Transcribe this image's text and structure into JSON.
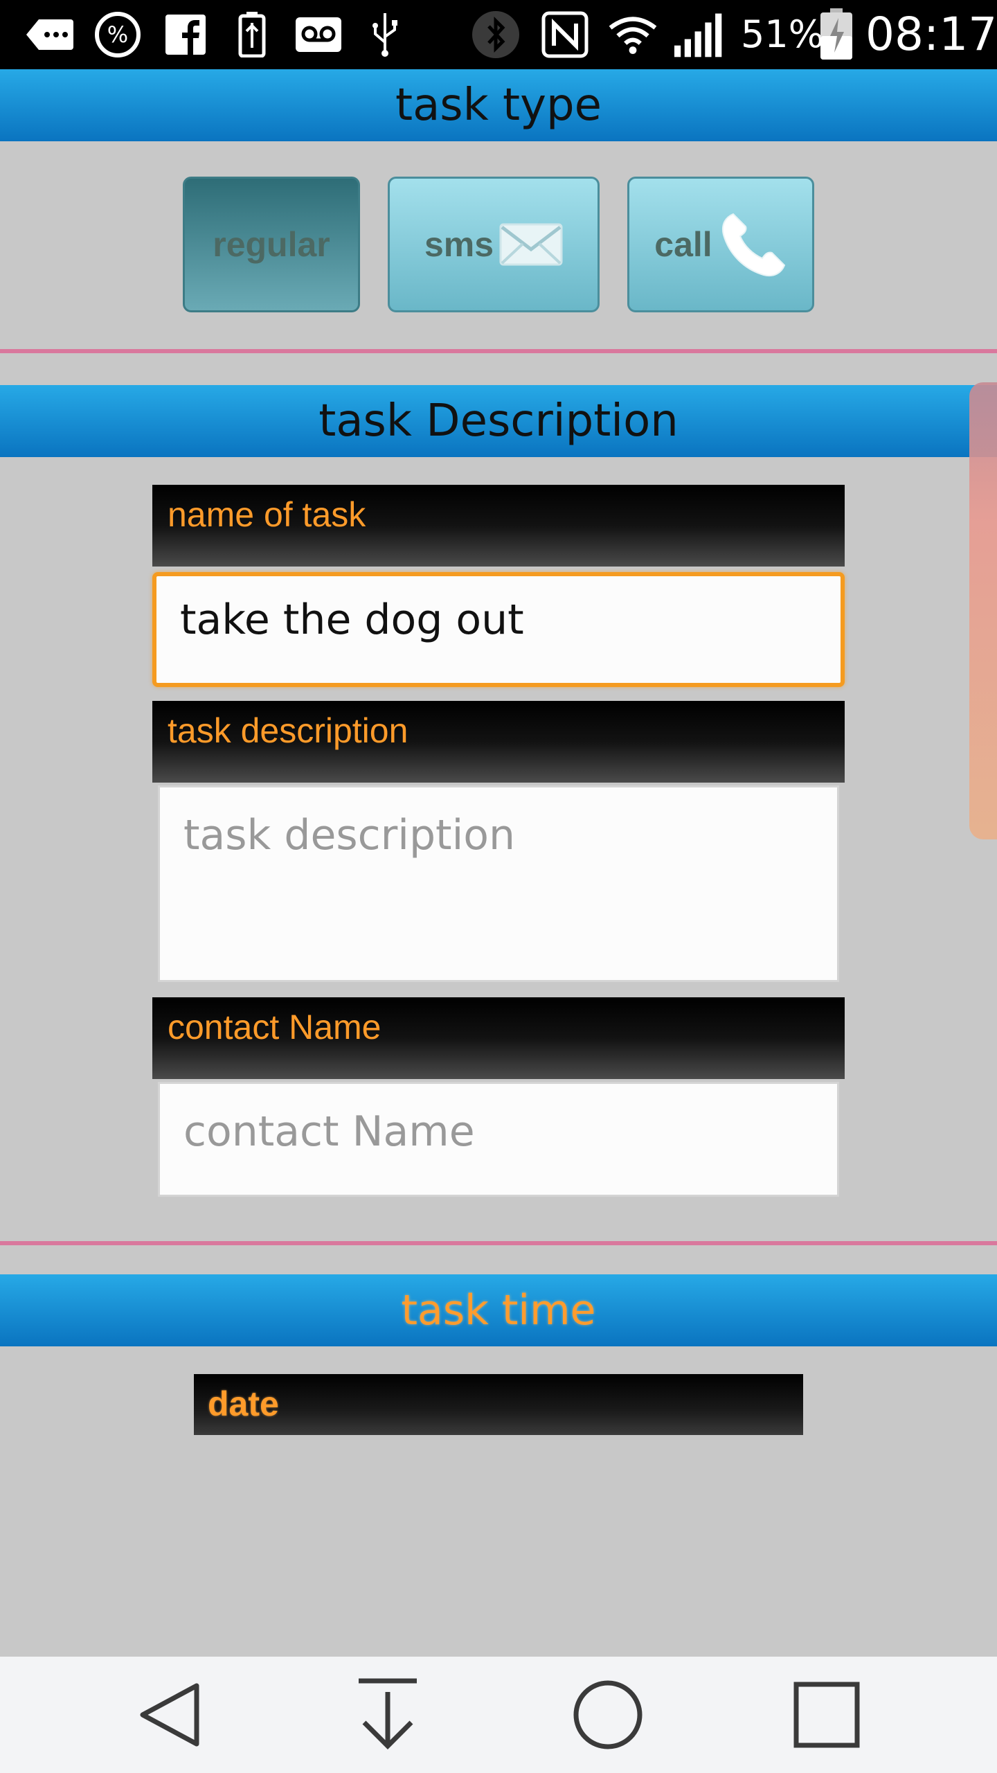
{
  "status_bar": {
    "battery_percent": "51%",
    "time": "08:17",
    "icons": [
      "more-icon",
      "percent-icon",
      "facebook-icon",
      "usb-battery-icon",
      "voicemail-icon",
      "usb-icon",
      "bluetooth-icon",
      "nfc-icon",
      "wifi-icon",
      "signal-icon",
      "battery-charging-icon"
    ]
  },
  "task_type": {
    "header": "task type",
    "buttons": [
      {
        "label": "regular",
        "active": true
      },
      {
        "label": "sms",
        "icon": "envelope-icon"
      },
      {
        "label": "call",
        "icon": "phone-icon"
      }
    ]
  },
  "task_description": {
    "header": "task Description",
    "name_label": "name of task",
    "name_value": "take the dog out",
    "description_label": "task description",
    "description_placeholder": "task description",
    "contact_label": "contact Name",
    "contact_placeholder": "contact Name"
  },
  "task_time": {
    "header": "task time",
    "date_label": "date"
  },
  "nav_bar": {
    "buttons": [
      "back-icon",
      "download-icon",
      "home-icon",
      "recents-icon"
    ]
  },
  "colors": {
    "header_blue": "#1a8fd6",
    "label_orange": "#ff9b2a",
    "divider_pink": "#d9789d",
    "focus_orange": "#f59b20"
  }
}
